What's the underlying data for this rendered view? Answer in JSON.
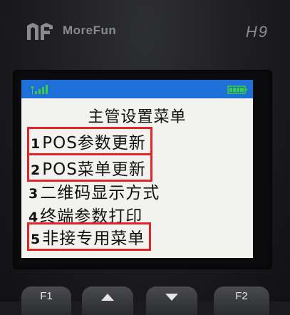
{
  "device": {
    "brand": "MoreFun",
    "model": "H9"
  },
  "status_bar": {
    "signal_icon": "signal-strength-icon",
    "battery_icon": "battery-full-icon",
    "bar_color": "#1f6fd8",
    "battery_color": "#3ad13a"
  },
  "menu": {
    "title": "主管设置菜单",
    "items": [
      {
        "num": "1",
        "label": "POS参数更新",
        "highlighted": true
      },
      {
        "num": "2",
        "label": "POS菜单更新",
        "highlighted": true
      },
      {
        "num": "3",
        "label": "二维码显示方式",
        "highlighted": false
      },
      {
        "num": "4",
        "label": "终端参数打印",
        "highlighted": false
      },
      {
        "num": "5",
        "label": "非接专用菜单",
        "highlighted": true
      }
    ],
    "highlight_color": "#e0262a"
  },
  "keys": {
    "f1": "F1",
    "up": "up-arrow-icon",
    "down": "down-arrow-icon",
    "f2": "F2"
  }
}
